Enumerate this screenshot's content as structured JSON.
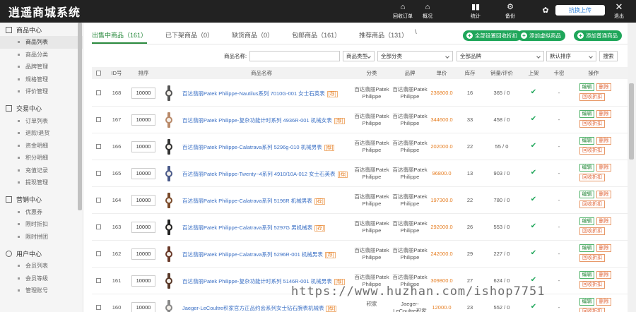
{
  "app_title": "逍遥商城系统",
  "topnav": [
    {
      "label": "回收订单",
      "icon": "home-icon"
    },
    {
      "label": "概况",
      "icon": "home-icon"
    },
    {
      "label": "统计",
      "icon": "bar-chart-icon"
    },
    {
      "label": "备份",
      "icon": "gear-icon"
    },
    {
      "label": "",
      "icon": "baidu-paw-icon"
    },
    {
      "label": "退出",
      "icon": "close-icon"
    }
  ],
  "upload_label": "抗换上传",
  "sidebar": [
    {
      "title": "商品中心",
      "items": [
        "商品列表",
        "商品分类",
        "品牌管理",
        "规格管理",
        "评价管理"
      ]
    },
    {
      "title": "交易中心",
      "items": [
        "订单列表",
        "退款/退货",
        "资金明细",
        "积分明细",
        "充值记录",
        "提现管理"
      ]
    },
    {
      "title": "营销中心",
      "items": [
        "优惠券",
        "限时折扣",
        "限时拼团"
      ]
    },
    {
      "title": "用户中心",
      "items": [
        "会员列表",
        "会员等级",
        "管理账号"
      ]
    }
  ],
  "tabs": [
    "出售中商品（161）",
    "已下架商品（0）",
    "缺货商品（0）",
    "包邮商品（161）",
    "推荐商品（131）"
  ],
  "tab_tick": "\\",
  "actions": [
    "全部设置回收折扣",
    "添加虚拟商品",
    "添加普通商品"
  ],
  "filters": {
    "name_label": "商品名称:",
    "type_select": "商品类型",
    "cat_select": "全部分类",
    "brand_select": "全部品牌",
    "sort_select": "默认排序",
    "search": "搜索"
  },
  "columns": [
    "ID号",
    "排序",
    "商品名称",
    "分类",
    "品牌",
    "单价",
    "库存",
    "销量/评价",
    "上架",
    "卡密",
    "操作"
  ],
  "op_labels": {
    "edit": "编辑",
    "del": "删除",
    "rec": "回收折扣"
  },
  "stock_tag": "[荐]",
  "rows": [
    {
      "id": "168",
      "sort": "10000",
      "name": "百达翡丽Patek Philippe-Nautilus系列 7010G-001 女士石英表",
      "cat": "百达翡丽Patek Philippe",
      "brand": "百达翡丽Patek Philippe",
      "price": "236800.0",
      "stock": "16",
      "sales": "365 / 0",
      "card": "-",
      "thumb": "#555"
    },
    {
      "id": "167",
      "sort": "10000",
      "name": "百达翡丽Patek Philippe-复杂功能计时系列 4936R-001 机械女表",
      "cat": "百达翡丽Patek Philippe",
      "brand": "百达翡丽Patek Philippe",
      "price": "344600.0",
      "stock": "33",
      "sales": "458 / 0",
      "card": "-",
      "thumb": "#b98a6a"
    },
    {
      "id": "166",
      "sort": "10000",
      "name": "百达翡丽Patek Philippe-Calatrava系列 5296g-010 机械男表",
      "cat": "百达翡丽Patek Philippe",
      "brand": "百达翡丽Patek Philippe",
      "price": "202000.0",
      "stock": "22",
      "sales": "55 / 0",
      "card": "-",
      "thumb": "#333"
    },
    {
      "id": "165",
      "sort": "10000",
      "name": "百达翡丽Patek Philippe-Twenty~4系列 4910/10A-012 女士石英表",
      "cat": "百达翡丽Patek Philippe",
      "brand": "百达翡丽Patek Philippe",
      "price": "96800.0",
      "stock": "13",
      "sales": "903 / 0",
      "card": "-",
      "thumb": "#4a5a8a"
    },
    {
      "id": "164",
      "sort": "10000",
      "name": "百达翡丽Patek Philippe-Calatrava系列 5196R 机械男表",
      "cat": "百达翡丽Patek Philippe",
      "brand": "百达翡丽Patek Philippe",
      "price": "197300.0",
      "stock": "22",
      "sales": "780 / 0",
      "card": "-",
      "thumb": "#7a4a2a"
    },
    {
      "id": "163",
      "sort": "10000",
      "name": "百达翡丽Patek Philippe-Calatrava系列 5297G 男机械表",
      "cat": "百达翡丽Patek Philippe",
      "brand": "百达翡丽Patek Philippe",
      "price": "292000.0",
      "stock": "26",
      "sales": "553 / 0",
      "card": "-",
      "thumb": "#222"
    },
    {
      "id": "162",
      "sort": "10000",
      "name": "百达翡丽Patek Philippe-Calatrava系列 5296R-001 机械男表",
      "cat": "百达翡丽Patek Philippe",
      "brand": "百达翡丽Patek Philippe",
      "price": "242000.0",
      "stock": "29",
      "sales": "227 / 0",
      "card": "-",
      "thumb": "#6a3a2a"
    },
    {
      "id": "161",
      "sort": "10000",
      "name": "百达翡丽Patek Philippe-复杂功能计时系列 5146R-001 机械男表",
      "cat": "百达翡丽Patek Philippe",
      "brand": "百达翡丽Patek Philippe",
      "price": "309800.0",
      "stock": "27",
      "sales": "624 / 0",
      "card": "-",
      "thumb": "#5a3a2a"
    },
    {
      "id": "160",
      "sort": "10000",
      "name": "Jaeger-LeCoultre积家官方正品约会系列女士钻石腕表机械表",
      "cat": "积家",
      "brand": "Jaeger-LeCoultre积家",
      "price": "12000.0",
      "stock": "23",
      "sales": "552 / 0",
      "card": "-",
      "thumb": "#888"
    }
  ],
  "watermark": "https://www.huzhan.com/ishop7751",
  "colors": {
    "topbar": "#222222",
    "accent": "#1fa65a",
    "price": "#e67e22",
    "link": "#3a6fc4"
  }
}
